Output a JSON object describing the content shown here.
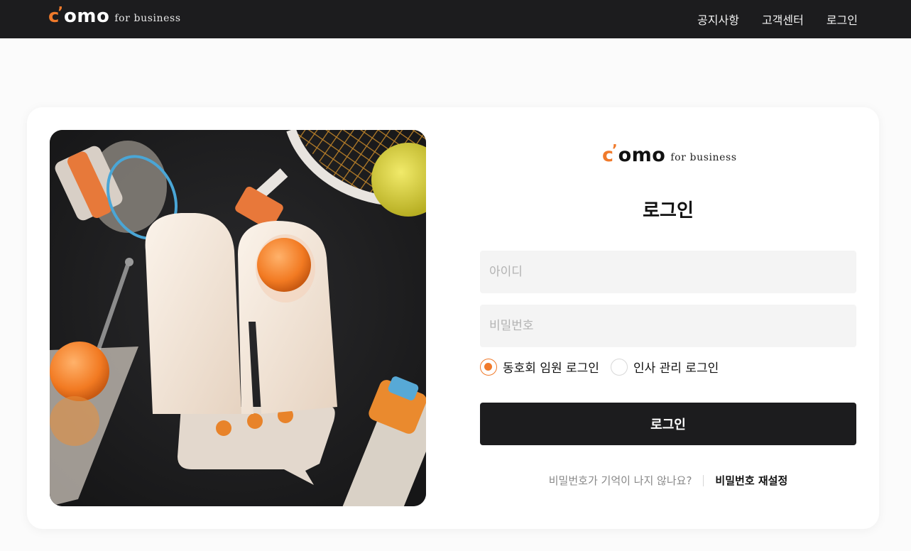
{
  "header": {
    "brand": {
      "c": "c",
      "apostrophe": "’",
      "omo": "omo",
      "suffix": "for business"
    },
    "nav": [
      "공지사항",
      "고객센터",
      "로그인"
    ]
  },
  "login": {
    "logo": {
      "c": "c",
      "apostrophe": "’",
      "omo": "omo",
      "suffix": "for business"
    },
    "title": "로그인",
    "id_placeholder": "아이디",
    "password_placeholder": "비밀번호",
    "login_types": [
      {
        "label": "동호회 임원 로그인",
        "selected": true
      },
      {
        "label": "인사 관리 로그인",
        "selected": false
      }
    ],
    "submit_label": "로그인",
    "forgot_question": "비밀번호가 기억이 나지 않나요?",
    "reset_link": "비밀번호 재설정"
  },
  "colors": {
    "accent": "#f07a2b",
    "dark": "#1c1c1e",
    "input_bg": "#f4f4f4"
  }
}
